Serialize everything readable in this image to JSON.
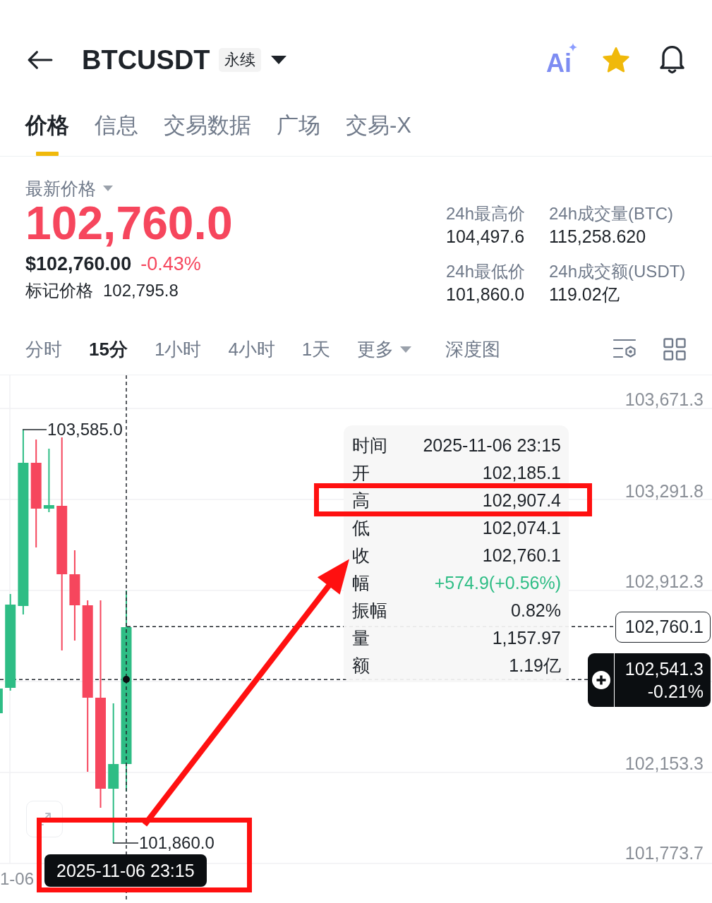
{
  "header": {
    "title": "BTCUSDT",
    "badge": "永续",
    "ai_label": "Ai",
    "favorited": true
  },
  "tabs": [
    {
      "label": "价格",
      "selected": true
    },
    {
      "label": "信息",
      "selected": false
    },
    {
      "label": "交易数据",
      "selected": false
    },
    {
      "label": "广场",
      "selected": false
    },
    {
      "label": "交易-X",
      "selected": false
    }
  ],
  "price": {
    "label": "最新价格",
    "last": "102,760.0",
    "negative": true,
    "usd": "$102,760.00",
    "change": "-0.43%",
    "mark_label": "标记价格",
    "mark_value": "102,795.8"
  },
  "stats": [
    {
      "label": "24h最高价",
      "value": "104,497.6"
    },
    {
      "label": "24h成交量(BTC)",
      "value": "115,258.620"
    },
    {
      "label": "24h最低价",
      "value": "101,860.0"
    },
    {
      "label": "24h成交额(USDT)",
      "value": "119.02亿"
    }
  ],
  "intervals": [
    {
      "label": "分时",
      "selected": false,
      "dropdown": false
    },
    {
      "label": "15分",
      "selected": true,
      "dropdown": false
    },
    {
      "label": "1小时",
      "selected": false,
      "dropdown": false
    },
    {
      "label": "4小时",
      "selected": false,
      "dropdown": false
    },
    {
      "label": "1天",
      "selected": false,
      "dropdown": false
    },
    {
      "label": "更多",
      "selected": false,
      "dropdown": true
    },
    {
      "label": "深度图",
      "selected": false,
      "dropdown": false
    }
  ],
  "chart": {
    "price_axis": [
      "103,671.3",
      "103,291.8",
      "102,912.3",
      "102,153.3",
      "101,773.7"
    ],
    "high_marker": "103,585.0",
    "low_marker": "101,860.0",
    "candles": [
      {
        "color": "#2ebd85"
      },
      {
        "color": "#2ebd85"
      },
      {
        "color": "#2ebd85"
      },
      {
        "color": "#f6465d"
      },
      {
        "color": "#2ebd85"
      },
      {
        "color": "#f6465d"
      },
      {
        "color": "#f6465d"
      },
      {
        "color": "#f6465d"
      },
      {
        "color": "#f6465d"
      },
      {
        "color": "#2ebd85"
      },
      {
        "color": "#2ebd85"
      }
    ],
    "tooltip": [
      {
        "label": "时间",
        "value": "2025-11-06 23:15",
        "color": "#1e2329"
      },
      {
        "label": "开",
        "value": "102,185.1",
        "color": "#1e2329"
      },
      {
        "label": "高",
        "value": "102,907.4",
        "color": "#1e2329"
      },
      {
        "label": "低",
        "value": "102,074.1",
        "color": "#1e2329"
      },
      {
        "label": "收",
        "value": "102,760.1",
        "color": "#1e2329"
      },
      {
        "label": "幅",
        "value": "+574.9(+0.56%)",
        "color": "#2ebd85"
      },
      {
        "label": "振幅",
        "value": "0.82%",
        "color": "#1e2329"
      },
      {
        "label": "量",
        "value": "1,157.97",
        "color": "#1e2329"
      },
      {
        "label": "额",
        "value": "1.19亿",
        "color": "#1e2329"
      }
    ],
    "last_price_tag": "102,760.1",
    "crosshair_tag": {
      "price": "102,541.3",
      "change": "-0.21%"
    },
    "time_axis_label": "1-06",
    "crosshair_time": "2025-11-06 23:15",
    "annotations": [
      {
        "kind": "box"
      },
      {
        "kind": "arrow"
      },
      {
        "kind": "box"
      }
    ]
  }
}
